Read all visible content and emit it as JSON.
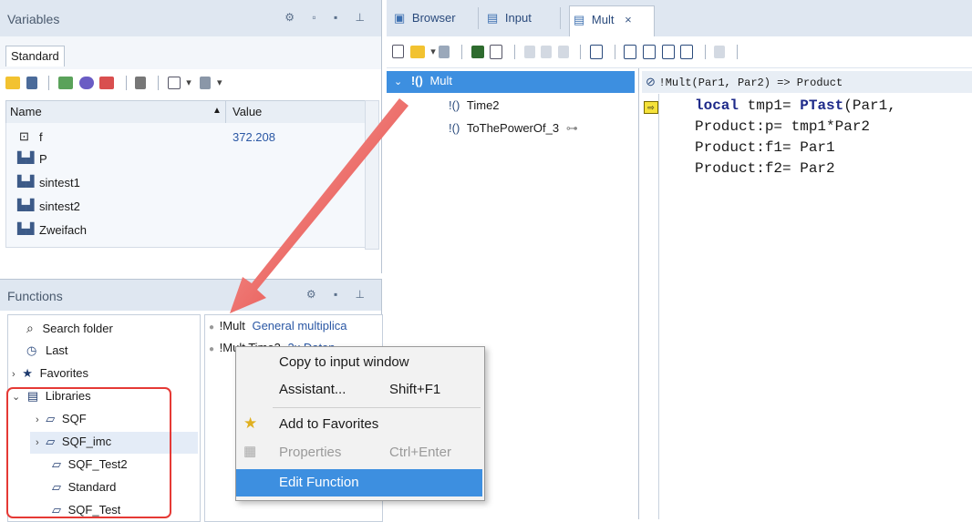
{
  "variables_panel": {
    "title": "Variables",
    "tab": "Standard",
    "columns": [
      "Name",
      "Value"
    ],
    "rows": [
      {
        "name": "f",
        "value": "372.208",
        "icon": "scalar-icon"
      },
      {
        "name": "P",
        "value": "",
        "icon": "waveform-icon"
      },
      {
        "name": "sintest1",
        "value": "",
        "icon": "waveform-icon"
      },
      {
        "name": "sintest2",
        "value": "",
        "icon": "waveform-icon"
      },
      {
        "name": "Zweifach",
        "value": "",
        "icon": "waveform-icon"
      }
    ]
  },
  "functions_panel": {
    "title": "Functions",
    "tree": [
      {
        "label": "Search folder",
        "icon": "search-icon"
      },
      {
        "label": "Last",
        "icon": "clock-icon"
      },
      {
        "label": "Favorites",
        "icon": "star-icon"
      },
      {
        "label": "Libraries",
        "icon": "books-icon"
      },
      {
        "label": "SQF",
        "icon": "book-icon"
      },
      {
        "label": "SQF_imc",
        "icon": "book-icon"
      },
      {
        "label": "SQF_Test2",
        "icon": "book-icon"
      },
      {
        "label": "Standard",
        "icon": "book-icon"
      },
      {
        "label": "SQF_Test",
        "icon": "book-icon"
      }
    ],
    "list": [
      {
        "name": "!Mult",
        "desc": "General multiplica"
      },
      {
        "name": "!Mult Time2",
        "desc": "2x Daten"
      }
    ]
  },
  "context_menu": {
    "items": [
      {
        "label": "Copy to input window",
        "shortcut": ""
      },
      {
        "label": "Assistant...",
        "shortcut": "Shift+F1"
      },
      {
        "label": "Add to Favorites",
        "shortcut": ""
      },
      {
        "label": "Properties",
        "shortcut": "Ctrl+Enter"
      },
      {
        "label": "Edit Function",
        "shortcut": ""
      }
    ]
  },
  "editor": {
    "tabs": [
      {
        "label": "Browser"
      },
      {
        "label": "Input"
      },
      {
        "label": "Mult"
      }
    ],
    "close_glyph": "×",
    "tree": {
      "root": "Mult",
      "children": [
        "Time2",
        "ToThePowerOf_3"
      ]
    },
    "signature": "!Mult(Par1, Par2) => Product",
    "code": {
      "line1_kw": "local",
      "line1_mid": " tmp1= ",
      "line1_fn": "PTast",
      "line1_end": "(Par1,",
      "line2": "Product:p= tmp1*Par2",
      "line3": "Product:f1= Par1",
      "line4": "Product:f2= Par2"
    }
  },
  "colors": {
    "panel_header": "#dfe7f1",
    "selection": "#3d8fe0",
    "highlight_box": "#e53935",
    "arrow": "#e3342f"
  }
}
